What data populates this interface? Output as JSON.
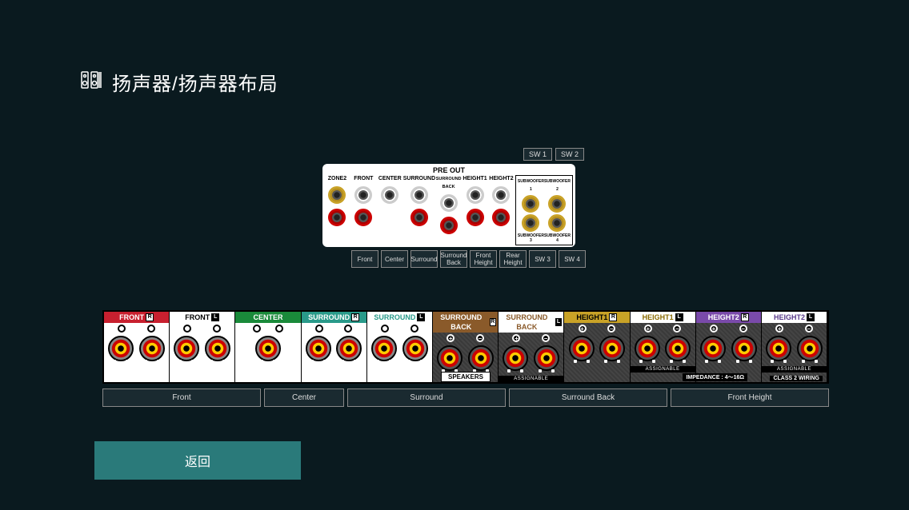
{
  "header": {
    "title": "扬声器/扬声器布局"
  },
  "preout": {
    "title": "PRE OUT",
    "sw_top": [
      "SW 1",
      "SW 2"
    ],
    "columns": [
      "ZONE2",
      "FRONT",
      "CENTER",
      "SURROUND",
      "SURROUND BACK",
      "HEIGHT1",
      "HEIGHT2"
    ],
    "sub": {
      "top": [
        "SUBWOOFER 1",
        "SUBWOOFER 2"
      ],
      "bottom": [
        "SUBWOOFER 3",
        "SUBWOOFER 4"
      ]
    },
    "buttons": [
      "Front",
      "Center",
      "Surround",
      "Surround Back",
      "Front Height",
      "Rear Height",
      "SW 3",
      "SW 4"
    ]
  },
  "speakers": {
    "title": "SPEAKERS",
    "impedance": "IMPEDANCE : 4〜16Ω",
    "class2": "CLASS 2 WIRING",
    "assignable": "ASSIGNABLE",
    "channels": [
      {
        "label": "FRONT",
        "ch": "R",
        "bg": "white",
        "hdr": "hdr-red"
      },
      {
        "label": "FRONT",
        "ch": "L",
        "bg": "white",
        "hdr": "hdr-white"
      },
      {
        "label": "CENTER",
        "ch": "",
        "bg": "white",
        "hdr": "hdr-green"
      },
      {
        "label": "SURROUND",
        "ch": "R",
        "bg": "white",
        "hdr": "hdr-teal"
      },
      {
        "label": "SURROUND",
        "ch": "L",
        "bg": "white",
        "hdr": "hdr-tealw"
      },
      {
        "label": "SURROUND BACK",
        "ch": "R",
        "bg": "dark",
        "hdr": "hdr-brown"
      },
      {
        "label": "SURROUND BACK",
        "ch": "L",
        "bg": "dark",
        "hdr": "hdr-brownw"
      },
      {
        "label": "HEIGHT1",
        "ch": "R",
        "bg": "dark",
        "hdr": "hdr-gold"
      },
      {
        "label": "HEIGHT1",
        "ch": "L",
        "bg": "dark",
        "hdr": "hdr-goldw"
      },
      {
        "label": "HEIGHT2",
        "ch": "R",
        "bg": "dark",
        "hdr": "hdr-purple"
      },
      {
        "label": "HEIGHT2",
        "ch": "L",
        "bg": "dark",
        "hdr": "hdr-purplew"
      }
    ],
    "buttons": [
      "Front",
      "Center",
      "Surround",
      "Surround Back",
      "Front Height"
    ]
  },
  "back": "返回"
}
